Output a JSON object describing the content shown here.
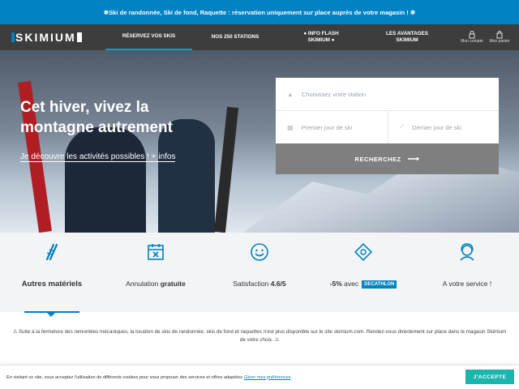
{
  "banner": {
    "text": "❄Ski de randonnée, Ski de fond, Raquette : réservation uniquement sur place auprès de votre magasin ! ❄"
  },
  "nav": {
    "logo": "SKIMIUM",
    "items": [
      {
        "label": "RÉSERVEZ VOS SKIS"
      },
      {
        "label": "NOS 250 STATIONS"
      },
      {
        "label": "● INFO FLASH SKIMIUM ●"
      },
      {
        "label": "LES AVANTAGES SKIMIUM"
      }
    ],
    "account_label": "Mon compte",
    "cart_label": "Mon panier"
  },
  "hero": {
    "title": "Cet hiver, vivez la montagne autrement",
    "link_text": "Je découvre les activités possibles ! + infos"
  },
  "search": {
    "station_placeholder": "Choisissez votre station",
    "first_day_placeholder": "Premier jour de ski",
    "last_day_placeholder": "Dernier jour de ski",
    "button_label": "RECHERCHEZ"
  },
  "features": [
    {
      "icon": "skis-icon",
      "label": "Autres matériels"
    },
    {
      "icon": "calendar-cancel-icon",
      "label_prefix": "Annulation ",
      "label_bold": "gratuite"
    },
    {
      "icon": "smiley-icon",
      "label_prefix": "Satisfaction ",
      "label_bold": "4.6/5"
    },
    {
      "icon": "ticket-discount-icon",
      "label_prefix": "-5%",
      "label_suffix": " avec",
      "brand": "DECATHLON"
    },
    {
      "icon": "support-agent-icon",
      "label": "A votre service !"
    }
  ],
  "notice": "⚠ Suite à la fermeture des remontées mécaniques, la location de skis de randonnée, skis de fond et raquettes n'est plus disponible sur le site skimium.com. Rendez-vous directement sur place dans le magasin Skimium de votre choix. ⚠",
  "cookie": {
    "text": "En visitant ce site, vous acceptez l'utilisation de différents cookies pour vous proposer des services et offres adaptées",
    "link": "Gérer mes préférences",
    "accept": "J'ACCEPTE"
  },
  "colors": {
    "brand_blue": "#0082c3",
    "nav_dark": "#3d3d3d",
    "accept_teal": "#1ab5ac",
    "search_button": "#7f7f7f"
  }
}
